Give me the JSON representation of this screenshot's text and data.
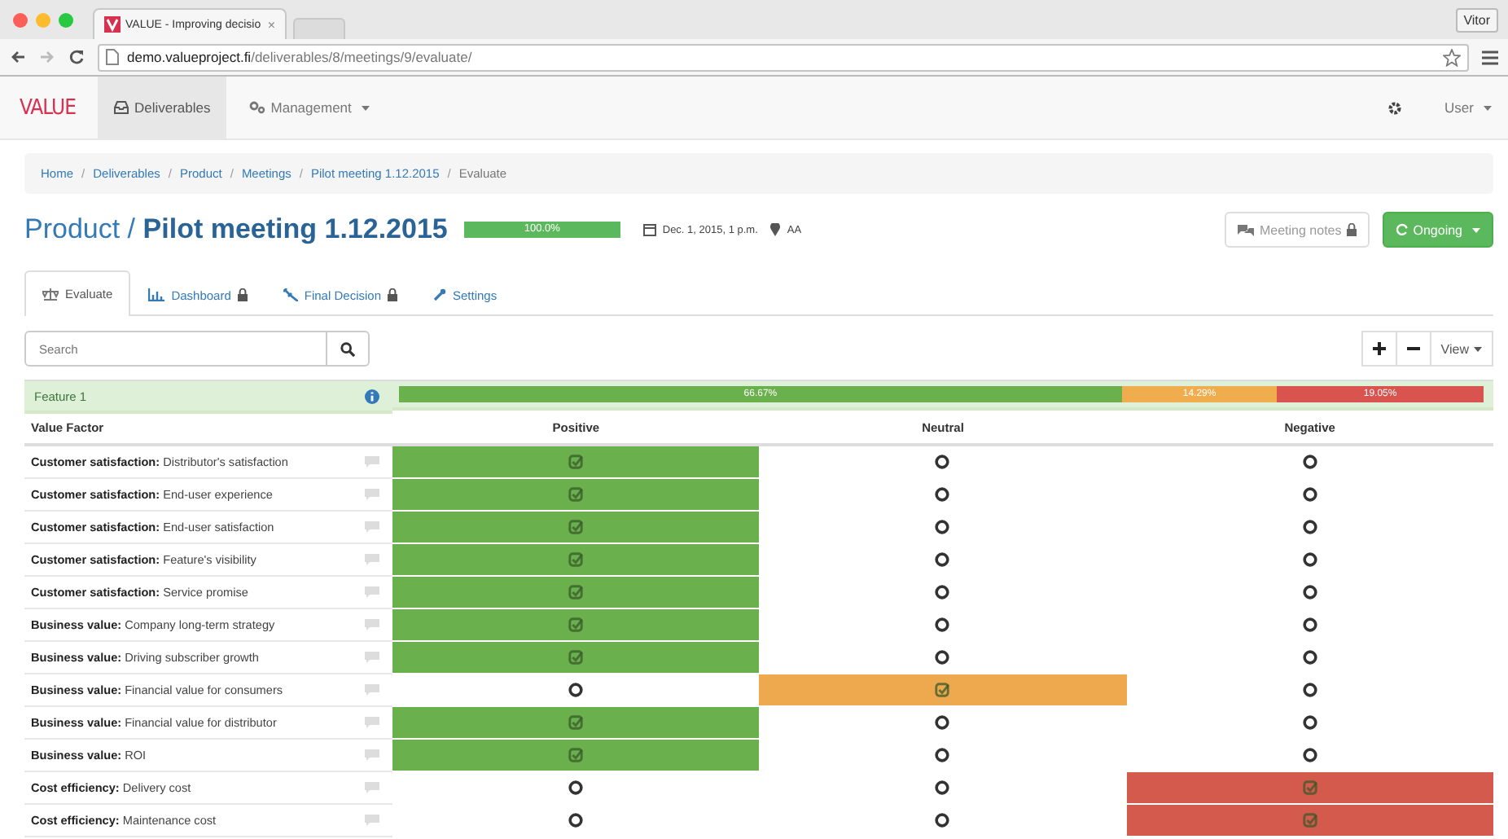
{
  "browser": {
    "tab_title": "VALUE - Improving decisio",
    "tab_close": "×",
    "profile": "Vitor",
    "url_host": "demo.valueproject.fi",
    "url_path": "/deliverables/8/meetings/9/evaluate/"
  },
  "navbar": {
    "brand": "VALUE",
    "items": [
      {
        "label": "Deliverables",
        "selected": true,
        "kind": "link"
      },
      {
        "label": "Management",
        "selected": false,
        "kind": "dropdown"
      }
    ],
    "user": "User"
  },
  "breadcrumb": [
    {
      "label": "Home"
    },
    {
      "sep": "/",
      "label": "Deliverables"
    },
    {
      "sep": "/",
      "label": "Product"
    },
    {
      "sep": "/",
      "label": "Meetings"
    },
    {
      "sep": "/",
      "label": "Pilot meeting 1.12.2015"
    },
    {
      "sep": "/",
      "label": "Evaluate"
    }
  ],
  "header": {
    "parent": "Product /",
    "title": "Pilot meeting 1.12.2015",
    "progress": {
      "level": 1,
      "label": "100.0%"
    },
    "date": "Dec. 1, 2015, 1 p.m.",
    "location": "AA",
    "notes_button": "Meeting notes",
    "status_button": "Ongoing"
  },
  "tabs": [
    {
      "label": "Evaluate",
      "selected": true,
      "locked": false,
      "kind": "scale"
    },
    {
      "label": "Dashboard",
      "selected": false,
      "locked": true,
      "kind": "chart"
    },
    {
      "label": "Final Decision",
      "selected": false,
      "locked": true,
      "kind": "gavel"
    },
    {
      "label": "Settings",
      "selected": false,
      "locked": false,
      "kind": "wrench"
    }
  ],
  "search": {
    "placeholder": "Search"
  },
  "view_button": "View",
  "feature": {
    "name": "Feature 1",
    "segments": [
      {
        "label": "66.67%",
        "color": "#6ab04c"
      },
      {
        "label": "14.29%",
        "color": "#f0ad4e"
      },
      {
        "label": "19.05%",
        "color": "#d9534f"
      }
    ]
  },
  "table": {
    "columns": [
      "Value Factor",
      "Positive",
      "Neutral",
      "Negative"
    ],
    "rows": [
      {
        "category": "Customer satisfaction:",
        "factor": "Distributor's satisfaction",
        "cells": [
          {
            "selected": true
          },
          {
            "selected": false
          },
          {
            "selected": false
          }
        ]
      },
      {
        "category": "Customer satisfaction:",
        "factor": "End-user experience",
        "cells": [
          {
            "selected": true
          },
          {
            "selected": false
          },
          {
            "selected": false
          }
        ]
      },
      {
        "category": "Customer satisfaction:",
        "factor": "End-user satisfaction",
        "cells": [
          {
            "selected": true
          },
          {
            "selected": false
          },
          {
            "selected": false
          }
        ]
      },
      {
        "category": "Customer satisfaction:",
        "factor": "Feature's visibility",
        "cells": [
          {
            "selected": true
          },
          {
            "selected": false
          },
          {
            "selected": false
          }
        ]
      },
      {
        "category": "Customer satisfaction:",
        "factor": "Service promise",
        "cells": [
          {
            "selected": true
          },
          {
            "selected": false
          },
          {
            "selected": false
          }
        ]
      },
      {
        "category": "Business value:",
        "factor": "Company long-term strategy",
        "cells": [
          {
            "selected": true
          },
          {
            "selected": false
          },
          {
            "selected": false
          }
        ]
      },
      {
        "category": "Business value:",
        "factor": "Driving subscriber growth",
        "cells": [
          {
            "selected": true
          },
          {
            "selected": false
          },
          {
            "selected": false
          }
        ]
      },
      {
        "category": "Business value:",
        "factor": "Financial value for consumers",
        "cells": [
          {
            "selected": false
          },
          {
            "selected": true
          },
          {
            "selected": false
          }
        ]
      },
      {
        "category": "Business value:",
        "factor": "Financial value for distributor",
        "cells": [
          {
            "selected": true
          },
          {
            "selected": false
          },
          {
            "selected": false
          }
        ]
      },
      {
        "category": "Business value:",
        "factor": "ROI",
        "cells": [
          {
            "selected": true
          },
          {
            "selected": false
          },
          {
            "selected": false
          }
        ]
      },
      {
        "category": "Cost efficiency:",
        "factor": "Delivery cost",
        "cells": [
          {
            "selected": false
          },
          {
            "selected": false
          },
          {
            "selected": true
          }
        ]
      },
      {
        "category": "Cost efficiency:",
        "factor": "Maintenance cost",
        "cells": [
          {
            "selected": false
          },
          {
            "selected": false
          },
          {
            "selected": true
          }
        ]
      }
    ]
  }
}
